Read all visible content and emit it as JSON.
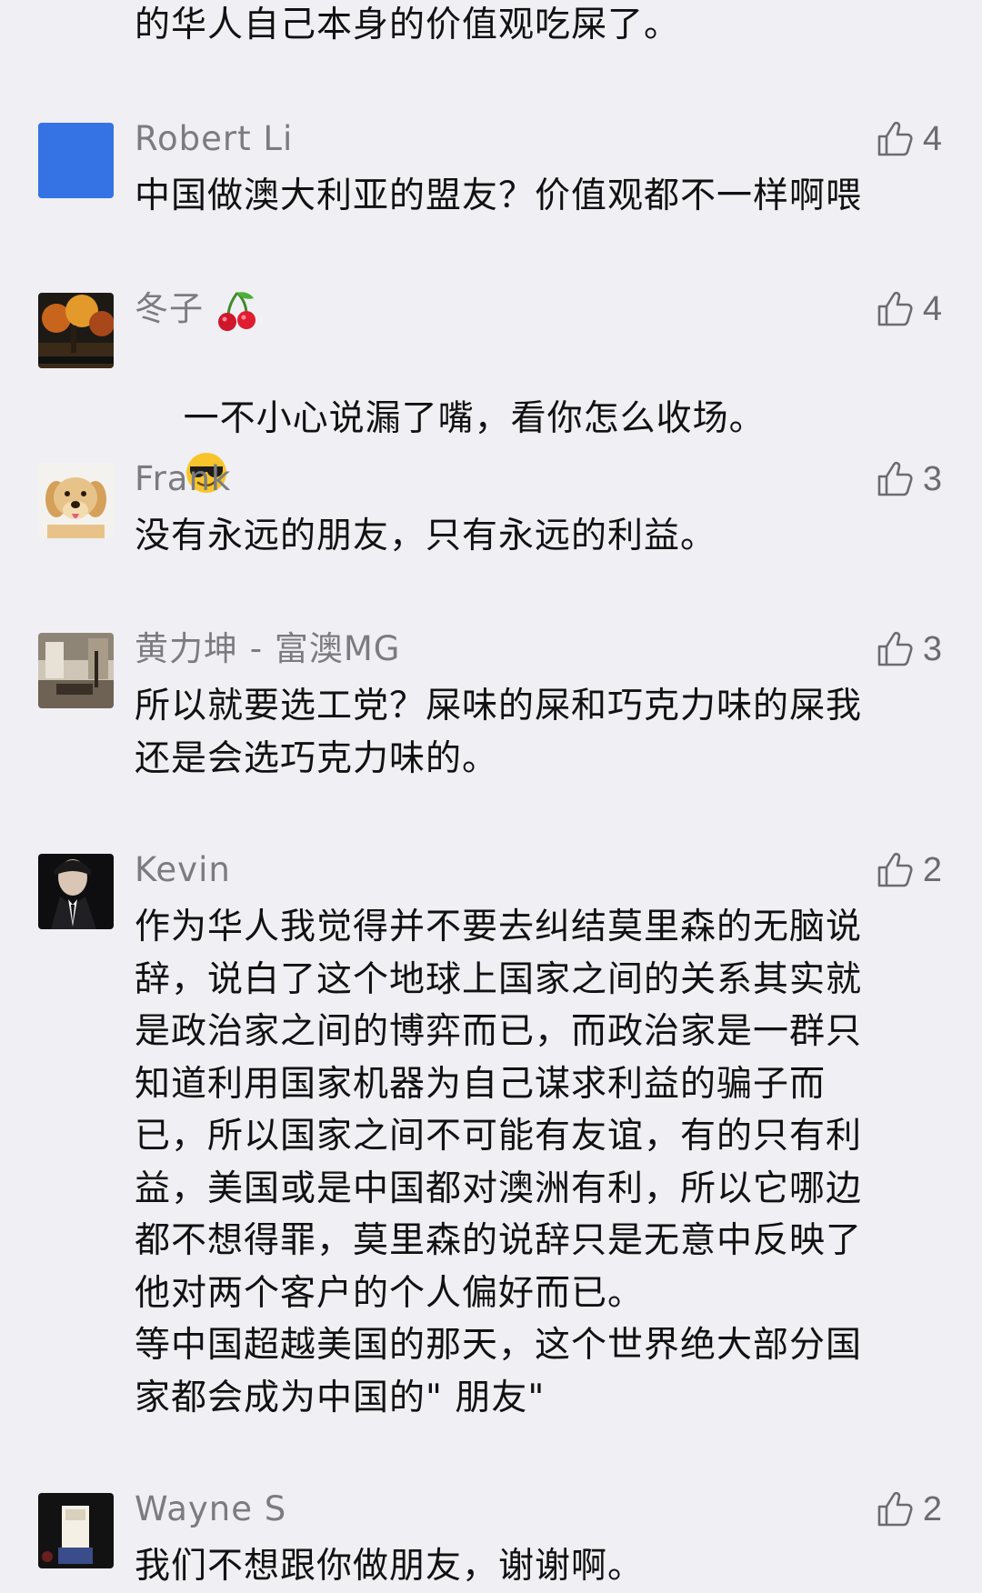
{
  "top_text": "的华人自己本身的价值观吃屎了。",
  "comments": [
    {
      "name": "Robert Li",
      "likes": "4",
      "text": "中国做澳大利亚的盟友？价值观都不一样啊喂",
      "avatar": "blue-square"
    },
    {
      "name": "冬子",
      "name_emoji": "cherry-emoji",
      "likes": "4",
      "text": "一不小心说漏了嘴，看你怎么收场。",
      "text_emoji": "sunglasses-emoji",
      "avatar": "autumn-tree-photo"
    },
    {
      "name": "Frank",
      "likes": "3",
      "text": "没有永远的朋友，只有永远的利益。",
      "avatar": "dog-photo"
    },
    {
      "name": "黄力坤 - 富澳MG",
      "likes": "3",
      "text": "所以就要选工党？屎味的屎和巧克力味的屎我\n还是会选巧克力味的。",
      "avatar": "interior-photo"
    },
    {
      "name": "Kevin",
      "likes": "2",
      "text": "作为华人我觉得并不要去纠结莫里森的无脑说\n辞，说白了这个地球上国家之间的关系其实就\n是政治家之间的博弈而已，而政治家是一群只\n知道利用国家机器为自己谋求利益的骗子而\n已，所以国家之间不可能有友谊，有的只有利\n益，美国或是中国都对澳洲有利，所以它哪边\n都不想得罪，莫里森的说辞只是无意中反映了\n他对两个客户的个人偏好而已。\n等中国超越美国的那天，这个世界绝大部分国\n家都会成为中国的\" 朋友\"",
      "avatar": "suit-person-photo"
    },
    {
      "name": "Wayne S",
      "likes": "2",
      "text": "我们不想跟你做朋友，谢谢啊。",
      "avatar": "dark-photo"
    }
  ],
  "colors": {
    "background": "#efeff4",
    "name": "#7b7b80",
    "text": "#111111",
    "like": "#6b6b70"
  }
}
